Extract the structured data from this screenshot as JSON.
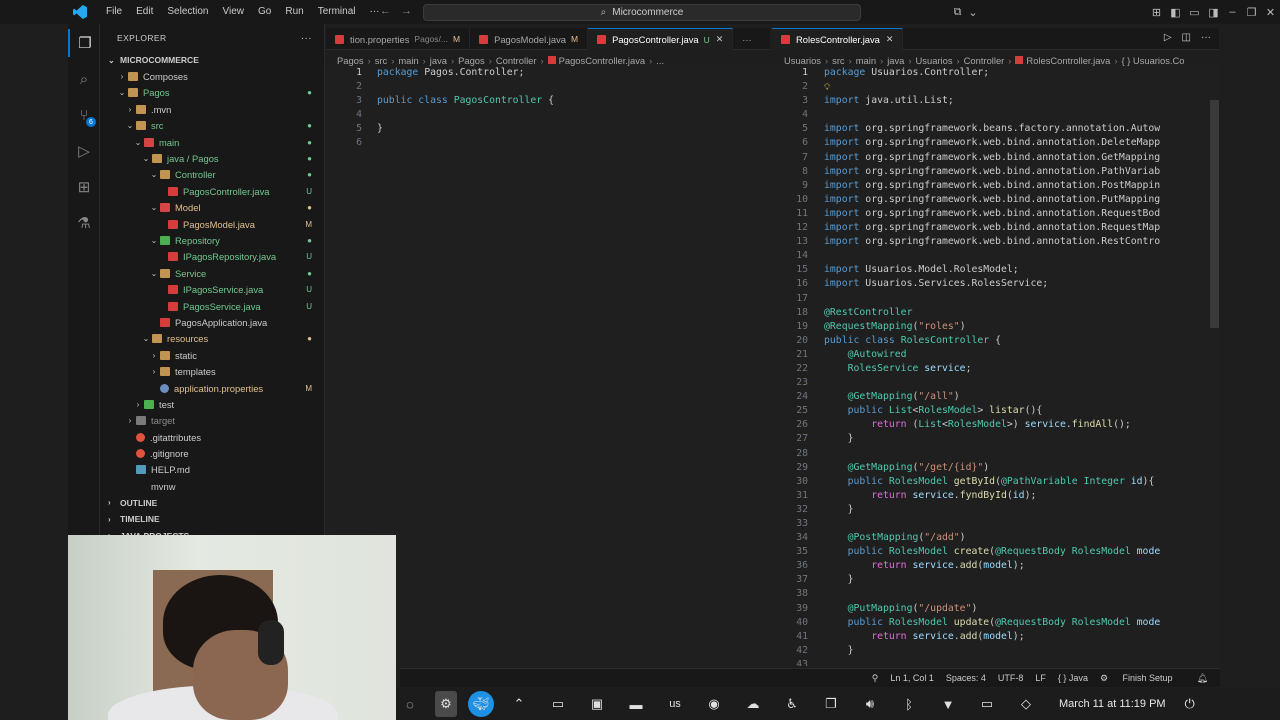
{
  "window": {
    "title": "Microcommerce",
    "menu": [
      "File",
      "Edit",
      "Selection",
      "View",
      "Go",
      "Run",
      "Terminal",
      "···"
    ]
  },
  "explorer": {
    "header": "EXPLORER",
    "more": "···",
    "root": "MICROCOMMERCE",
    "items": [
      {
        "label": "Composes",
        "depth": 1,
        "chev": "›",
        "icon": "folder",
        "color": "#cccccc"
      },
      {
        "label": "Pagos",
        "depth": 1,
        "chev": "⌄",
        "icon": "folder",
        "color": "#73c991",
        "dec": "●"
      },
      {
        "label": ".mvn",
        "depth": 2,
        "chev": "›",
        "icon": "folder",
        "color": "#cccccc"
      },
      {
        "label": "src",
        "depth": 2,
        "chev": "⌄",
        "icon": "folder",
        "color": "#73c991",
        "dec": "●"
      },
      {
        "label": "main",
        "depth": 3,
        "chev": "⌄",
        "icon": "folder-red",
        "color": "#73c991",
        "dec": "●"
      },
      {
        "label": "java / Pagos",
        "depth": 4,
        "chev": "⌄",
        "icon": "folder",
        "color": "#73c991",
        "dec": "●"
      },
      {
        "label": "Controller",
        "depth": 5,
        "chev": "⌄",
        "icon": "folder",
        "color": "#73c991",
        "dec": "●"
      },
      {
        "label": "PagosController.java",
        "depth": 6,
        "chev": "",
        "icon": "java",
        "color": "#73c991",
        "dec": "U"
      },
      {
        "label": "Model",
        "depth": 5,
        "chev": "⌄",
        "icon": "folder-red",
        "color": "#e2c08d",
        "dec": "●"
      },
      {
        "label": "PagosModel.java",
        "depth": 6,
        "chev": "",
        "icon": "java",
        "color": "#e2c08d",
        "dec": "M"
      },
      {
        "label": "Repository",
        "depth": 5,
        "chev": "⌄",
        "icon": "folder-green",
        "color": "#73c991",
        "dec": "●"
      },
      {
        "label": "IPagosRepository.java",
        "depth": 6,
        "chev": "",
        "icon": "java",
        "color": "#73c991",
        "dec": "U"
      },
      {
        "label": "Service",
        "depth": 5,
        "chev": "⌄",
        "icon": "folder",
        "color": "#73c991",
        "dec": "●"
      },
      {
        "label": "IPagosService.java",
        "depth": 6,
        "chev": "",
        "icon": "java",
        "color": "#73c991",
        "dec": "U"
      },
      {
        "label": "PagosService.java",
        "depth": 6,
        "chev": "",
        "icon": "java",
        "color": "#73c991",
        "dec": "U"
      },
      {
        "label": "PagosApplication.java",
        "depth": 5,
        "chev": "",
        "icon": "java",
        "color": "#cccccc"
      },
      {
        "label": "resources",
        "depth": 4,
        "chev": "⌄",
        "icon": "folder",
        "color": "#e2c08d",
        "dec": "●"
      },
      {
        "label": "static",
        "depth": 5,
        "chev": "›",
        "icon": "folder",
        "color": "#cccccc"
      },
      {
        "label": "templates",
        "depth": 5,
        "chev": "›",
        "icon": "folder",
        "color": "#cccccc"
      },
      {
        "label": "application.properties",
        "depth": 5,
        "chev": "",
        "icon": "gear",
        "color": "#e2c08d",
        "dec": "M"
      },
      {
        "label": "test",
        "depth": 3,
        "chev": "›",
        "icon": "folder-green",
        "color": "#cccccc"
      },
      {
        "label": "target",
        "depth": 2,
        "chev": "›",
        "icon": "folder-gray",
        "color": "#8c8c8c"
      },
      {
        "label": ".gitattributes",
        "depth": 2,
        "chev": "",
        "icon": "git",
        "color": "#cccccc"
      },
      {
        "label": ".gitignore",
        "depth": 2,
        "chev": "",
        "icon": "git",
        "color": "#cccccc"
      },
      {
        "label": "HELP.md",
        "depth": 2,
        "chev": "",
        "icon": "md",
        "color": "#cccccc"
      },
      {
        "label": "mvnw",
        "depth": 2,
        "chev": "",
        "icon": "none",
        "color": "#cccccc"
      }
    ],
    "sections": [
      "OUTLINE",
      "TIMELINE",
      "JAVA PROJECTS"
    ]
  },
  "left_group": {
    "tabs": [
      {
        "label": "tion.properties",
        "path": "Pagos/...",
        "status": "M",
        "active": false
      },
      {
        "label": "PagosModel.java",
        "status": "M",
        "active": false
      },
      {
        "label": "PagosController.java",
        "status": "U",
        "active": true
      }
    ],
    "breadcrumb": [
      "Pagos",
      "src",
      "main",
      "java",
      "Pagos",
      "Controller",
      "PagosController.java",
      "..."
    ],
    "lines": [
      [
        [
          "k",
          "package "
        ],
        [
          "n",
          "Pagos.Controller;"
        ]
      ],
      [],
      [
        [
          "k",
          "public class "
        ],
        [
          "t",
          "PagosController "
        ],
        [
          "n",
          "{"
        ]
      ],
      [],
      [
        [
          "n",
          "}"
        ]
      ],
      []
    ]
  },
  "right_group": {
    "tabs": [
      {
        "label": "RolesController.java",
        "active": true
      }
    ],
    "breadcrumb": [
      "Usuarios",
      "src",
      "main",
      "java",
      "Usuarios",
      "Controller",
      "RolesController.java",
      "{ } Usuarios.Co"
    ],
    "current_line": 1,
    "lines": [
      [
        [
          "k",
          "package "
        ],
        [
          "n",
          "Usuarios.Controller;"
        ]
      ],
      [],
      [
        [
          "k",
          "import "
        ],
        [
          "n",
          "java.util.List;"
        ]
      ],
      [],
      [
        [
          "k",
          "import "
        ],
        [
          "n",
          "org.springframework.beans.factory.annotation.Autow"
        ]
      ],
      [
        [
          "k",
          "import "
        ],
        [
          "n",
          "org.springframework.web.bind.annotation.DeleteMapp"
        ]
      ],
      [
        [
          "k",
          "import "
        ],
        [
          "n",
          "org.springframework.web.bind.annotation.GetMapping"
        ]
      ],
      [
        [
          "k",
          "import "
        ],
        [
          "n",
          "org.springframework.web.bind.annotation.PathVariab"
        ]
      ],
      [
        [
          "k",
          "import "
        ],
        [
          "n",
          "org.springframework.web.bind.annotation.PostMappin"
        ]
      ],
      [
        [
          "k",
          "import "
        ],
        [
          "n",
          "org.springframework.web.bind.annotation.PutMapping"
        ]
      ],
      [
        [
          "k",
          "import "
        ],
        [
          "n",
          "org.springframework.web.bind.annotation.RequestBod"
        ]
      ],
      [
        [
          "k",
          "import "
        ],
        [
          "n",
          "org.springframework.web.bind.annotation.RequestMap"
        ]
      ],
      [
        [
          "k",
          "import "
        ],
        [
          "n",
          "org.springframework.web.bind.annotation.RestContro"
        ]
      ],
      [],
      [
        [
          "k",
          "import "
        ],
        [
          "n",
          "Usuarios.Model.RolesModel;"
        ]
      ],
      [
        [
          "k",
          "import "
        ],
        [
          "n",
          "Usuarios.Services.RolesService;"
        ]
      ],
      [],
      [
        [
          "t",
          "@RestController"
        ]
      ],
      [
        [
          "t",
          "@RequestMapping"
        ],
        [
          "n",
          "("
        ],
        [
          "s",
          "\"roles\""
        ],
        [
          "n",
          ")"
        ]
      ],
      [
        [
          "k",
          "public class "
        ],
        [
          "t",
          "RolesController "
        ],
        [
          "n",
          "{"
        ]
      ],
      [
        [
          "n",
          "    "
        ],
        [
          "t",
          "@Autowired"
        ]
      ],
      [
        [
          "n",
          "    "
        ],
        [
          "t",
          "RolesService "
        ],
        [
          "v",
          "service"
        ],
        [
          "n",
          ";"
        ]
      ],
      [],
      [
        [
          "n",
          "    "
        ],
        [
          "t",
          "@GetMapping"
        ],
        [
          "n",
          "("
        ],
        [
          "s",
          "\"/all\""
        ],
        [
          "n",
          ")"
        ]
      ],
      [
        [
          "n",
          "    "
        ],
        [
          "k",
          "public "
        ],
        [
          "t",
          "List"
        ],
        [
          "n",
          "<"
        ],
        [
          "t",
          "RolesModel"
        ],
        [
          "n",
          "> "
        ],
        [
          "a",
          "listar"
        ],
        [
          "n",
          "(){"
        ]
      ],
      [
        [
          "n",
          "        "
        ],
        [
          "p",
          "return "
        ],
        [
          "n",
          "("
        ],
        [
          "t",
          "List"
        ],
        [
          "n",
          "<"
        ],
        [
          "t",
          "RolesModel"
        ],
        [
          "n",
          ">) "
        ],
        [
          "v",
          "service"
        ],
        [
          "n",
          "."
        ],
        [
          "a",
          "findAll"
        ],
        [
          "n",
          "();"
        ]
      ],
      [
        [
          "n",
          "    }"
        ]
      ],
      [],
      [
        [
          "n",
          "    "
        ],
        [
          "t",
          "@GetMapping"
        ],
        [
          "n",
          "("
        ],
        [
          "s",
          "\"/get/{id}\""
        ],
        [
          "n",
          ")"
        ]
      ],
      [
        [
          "n",
          "    "
        ],
        [
          "k",
          "public "
        ],
        [
          "t",
          "RolesModel "
        ],
        [
          "a",
          "getById"
        ],
        [
          "n",
          "("
        ],
        [
          "t",
          "@PathVariable "
        ],
        [
          "t",
          "Integer "
        ],
        [
          "v",
          "id"
        ],
        [
          "n",
          ")"
        ],
        [
          "n",
          "{"
        ]
      ],
      [
        [
          "n",
          "        "
        ],
        [
          "p",
          "return "
        ],
        [
          "v",
          "service"
        ],
        [
          "n",
          "."
        ],
        [
          "a",
          "fyndById"
        ],
        [
          "n",
          "("
        ],
        [
          "v",
          "id"
        ],
        [
          "n",
          ");"
        ]
      ],
      [
        [
          "n",
          "    }"
        ]
      ],
      [],
      [
        [
          "n",
          "    "
        ],
        [
          "t",
          "@PostMapping"
        ],
        [
          "n",
          "("
        ],
        [
          "s",
          "\"/add\""
        ],
        [
          "n",
          ")"
        ]
      ],
      [
        [
          "n",
          "    "
        ],
        [
          "k",
          "public "
        ],
        [
          "t",
          "RolesModel "
        ],
        [
          "a",
          "create"
        ],
        [
          "n",
          "("
        ],
        [
          "t",
          "@RequestBody "
        ],
        [
          "t",
          "RolesModel "
        ],
        [
          "v",
          "mode"
        ]
      ],
      [
        [
          "n",
          "        "
        ],
        [
          "p",
          "return "
        ],
        [
          "v",
          "service"
        ],
        [
          "n",
          "."
        ],
        [
          "a",
          "add"
        ],
        [
          "n",
          "("
        ],
        [
          "v",
          "model"
        ],
        [
          "n",
          ");"
        ]
      ],
      [
        [
          "n",
          "    }"
        ]
      ],
      [],
      [
        [
          "n",
          "    "
        ],
        [
          "t",
          "@PutMapping"
        ],
        [
          "n",
          "("
        ],
        [
          "s",
          "\"/update\""
        ],
        [
          "n",
          ")"
        ]
      ],
      [
        [
          "n",
          "    "
        ],
        [
          "k",
          "public "
        ],
        [
          "t",
          "RolesModel "
        ],
        [
          "a",
          "update"
        ],
        [
          "n",
          "("
        ],
        [
          "t",
          "@RequestBody "
        ],
        [
          "t",
          "RolesModel "
        ],
        [
          "v",
          "mode"
        ]
      ],
      [
        [
          "n",
          "        "
        ],
        [
          "p",
          "return "
        ],
        [
          "v",
          "service"
        ],
        [
          "n",
          "."
        ],
        [
          "a",
          "add"
        ],
        [
          "n",
          "("
        ],
        [
          "v",
          "model"
        ],
        [
          "n",
          ");"
        ]
      ],
      [
        [
          "n",
          "    }"
        ]
      ],
      [
        [
          "n",
          ""
        ]
      ]
    ]
  },
  "status": {
    "position": "Ln 1, Col 1",
    "spaces": "Spaces: 4",
    "encoding": "UTF-8",
    "eol": "LF",
    "language": "{ } Java",
    "finish": "Finish Setup"
  },
  "taskbar": {
    "lang": "us",
    "clock": "March 11 at 11:19 PM"
  }
}
